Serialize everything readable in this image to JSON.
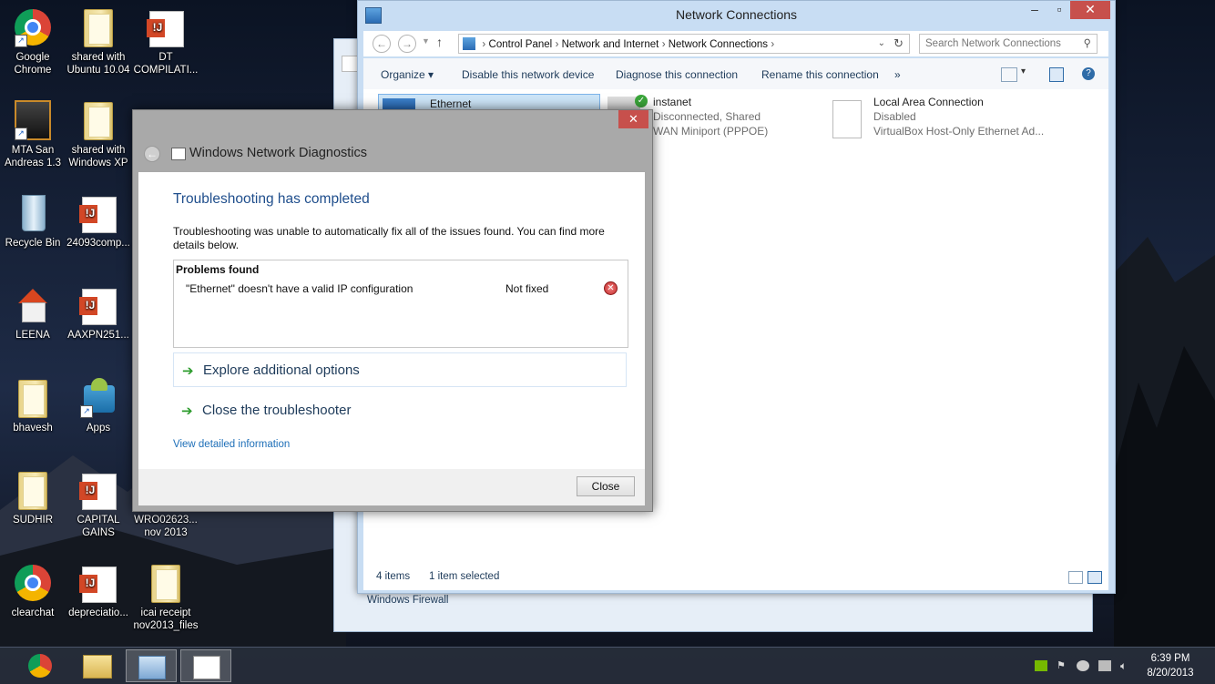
{
  "desktop": {
    "icons": [
      {
        "label": "Google Chrome",
        "type": "chrome-icon"
      },
      {
        "label": "shared with Ubuntu 10.04",
        "type": "folder-icon"
      },
      {
        "label": "DT COMPILATI...",
        "type": "document-icon"
      },
      {
        "label": "MTA San Andreas 1.3",
        "type": "game-icon"
      },
      {
        "label": "shared with Windows XP",
        "type": "folder-icon"
      },
      {
        "label": "Recycle Bin",
        "type": "recycle-bin-icon"
      },
      {
        "label": "24093comp...",
        "type": "document-icon"
      },
      {
        "label": "LEENA",
        "type": "home-icon"
      },
      {
        "label": "AAXPN251...",
        "type": "document-icon"
      },
      {
        "label": "bhavesh",
        "type": "folder-icon"
      },
      {
        "label": "Apps",
        "type": "apps-icon"
      },
      {
        "label": "SUDHIR",
        "type": "folder-icon"
      },
      {
        "label": "CAPITAL GAINS",
        "type": "document-icon"
      },
      {
        "label": "WRO02623... nov 2013",
        "type": "document-icon"
      },
      {
        "label": "clearchat",
        "type": "chrome-icon"
      },
      {
        "label": "depreciatio...",
        "type": "document-icon"
      },
      {
        "label": "icai receipt nov2013_files",
        "type": "folder-icon"
      }
    ]
  },
  "explorer": {
    "title": "Network Connections",
    "address": {
      "crumbs": [
        "Control Panel",
        "Network and Internet",
        "Network Connections"
      ]
    },
    "search_placeholder": "Search Network Connections",
    "commands": [
      "Organize",
      "Disable this network device",
      "Diagnose this connection",
      "Rename this connection",
      "»"
    ],
    "connections": [
      {
        "name": "Ethernet",
        "line1": "",
        "line2": ""
      },
      {
        "name": "instanet",
        "line1": "Disconnected, Shared",
        "line2": "WAN Miniport (PPPOE)"
      },
      {
        "name": "Local Area Connection",
        "line1": "Disabled",
        "line2": "VirtualBox Host-Only Ethernet Ad..."
      }
    ],
    "status_items": "4 items",
    "status_selected": "1 item selected"
  },
  "back_window": {
    "link": "Windows Firewall"
  },
  "dialog": {
    "title": "Windows Network Diagnostics",
    "heading": "Troubleshooting has completed",
    "message": "Troubleshooting was unable to automatically fix all of the issues found. You can find more details below.",
    "problems_header": "Problems found",
    "problems": [
      {
        "issue": "\"Ethernet\" doesn't have a valid IP configuration",
        "status": "Not fixed"
      }
    ],
    "options": [
      "Explore additional options",
      "Close the troubleshooter"
    ],
    "detail_link": "View detailed information",
    "close_button": "Close"
  },
  "taskbar": {
    "time": "6:39 PM",
    "date": "8/20/2013"
  }
}
